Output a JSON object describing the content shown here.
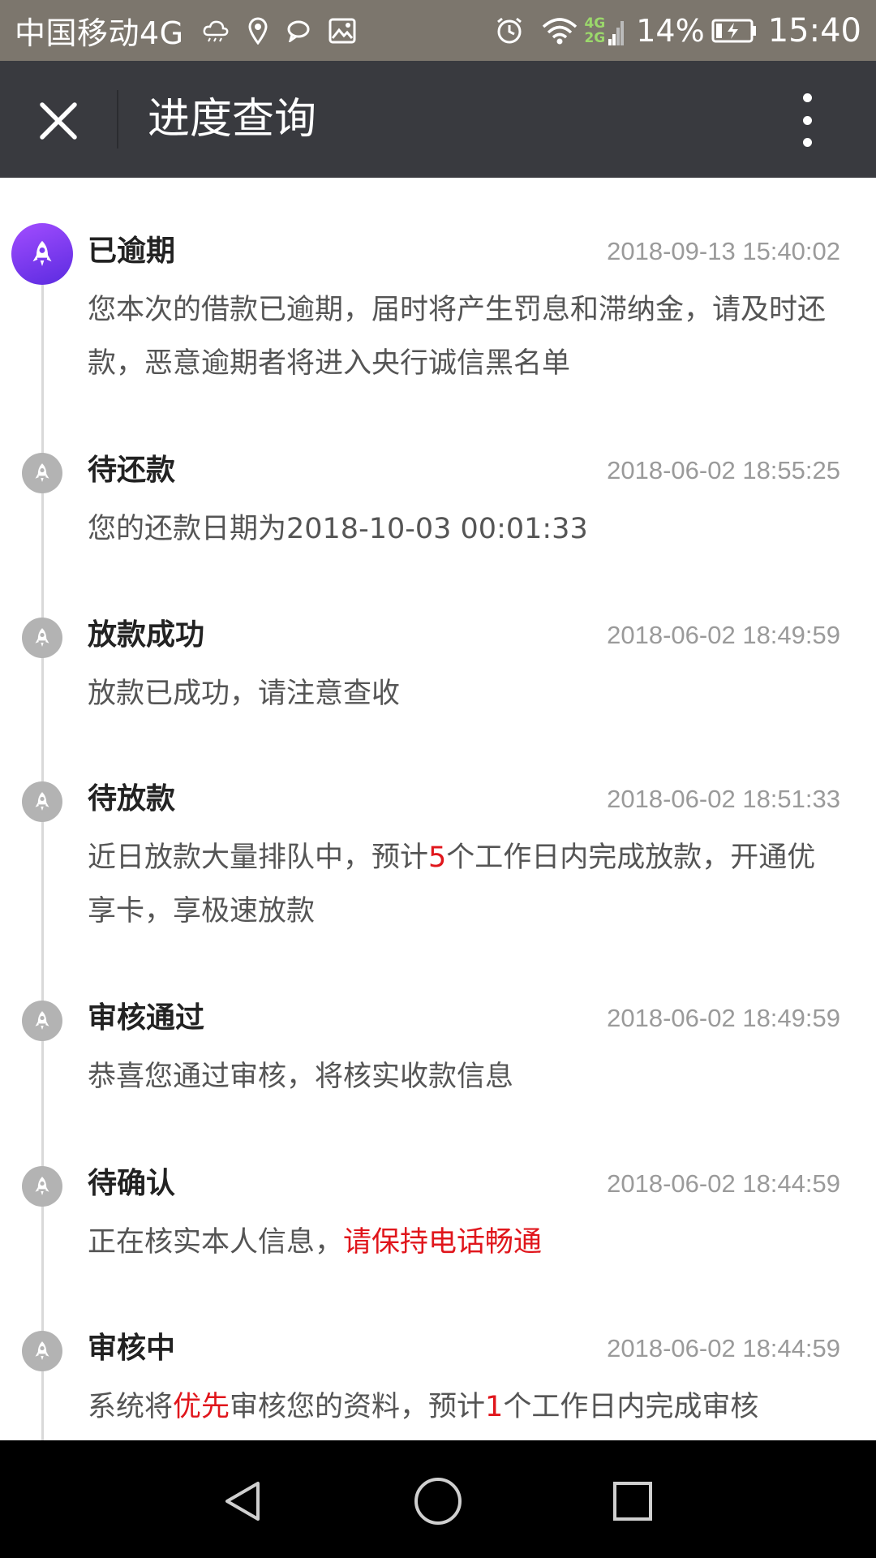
{
  "status_bar": {
    "carrier": "中国移动4G",
    "net_top": "4G",
    "net_bottom": "2G",
    "battery": "14%",
    "time": "15:40",
    "icons": [
      "weather-cloud-icon",
      "location-pin-icon",
      "chat-bubble-icon",
      "image-icon",
      "alarm-icon",
      "wifi-icon",
      "signal-icon",
      "battery-charging-icon"
    ]
  },
  "header": {
    "title": "进度查询",
    "close_icon": "close-icon",
    "more_icon": "more-vertical-icon"
  },
  "timeline": [
    {
      "status": "已逾期",
      "time": "2018-09-13 15:40:02",
      "desc": [
        {
          "t": "您本次的借款已逾期，届时将产生罚息和滞纳金，请及时还款，恶意逾期者将进入央行诚信黑名单",
          "red": false
        }
      ]
    },
    {
      "status": "待还款",
      "time": "2018-06-02 18:55:25",
      "desc": [
        {
          "t": "您的还款日期为2018-10-03 00:01:33",
          "red": false
        }
      ]
    },
    {
      "status": "放款成功",
      "time": "2018-06-02 18:49:59",
      "desc": [
        {
          "t": "放款已成功，请注意查收",
          "red": false
        }
      ]
    },
    {
      "status": "待放款",
      "time": "2018-06-02 18:51:33",
      "desc": [
        {
          "t": "近日放款大量排队中，预计",
          "red": false
        },
        {
          "t": "5",
          "red": true
        },
        {
          "t": "个工作日内完成放款，开通优享卡，享极速放款",
          "red": false
        }
      ]
    },
    {
      "status": "审核通过",
      "time": "2018-06-02 18:49:59",
      "desc": [
        {
          "t": "恭喜您通过审核，将核实收款信息",
          "red": false
        }
      ]
    },
    {
      "status": "待确认",
      "time": "2018-06-02 18:44:59",
      "desc": [
        {
          "t": "正在核实本人信息，",
          "red": false
        },
        {
          "t": "请保持电话畅通",
          "red": true
        }
      ]
    },
    {
      "status": "审核中",
      "time": "2018-06-02 18:44:59",
      "desc": [
        {
          "t": "系统将",
          "red": false
        },
        {
          "t": "优先",
          "red": true
        },
        {
          "t": "审核您的资料，预计",
          "red": false
        },
        {
          "t": "1",
          "red": true
        },
        {
          "t": "个工作日内完成审核",
          "red": false
        }
      ]
    }
  ],
  "nav_bar": {
    "back_icon": "back-triangle-icon",
    "home_icon": "home-circle-icon",
    "recents_icon": "recents-square-icon"
  },
  "colors": {
    "status_bar_bg": "#7c766d",
    "title_bar_bg": "#393a3f",
    "accent_red": "#e0161c",
    "active_node": "#7b3cf0",
    "inactive_node": "#b3b3b3"
  }
}
